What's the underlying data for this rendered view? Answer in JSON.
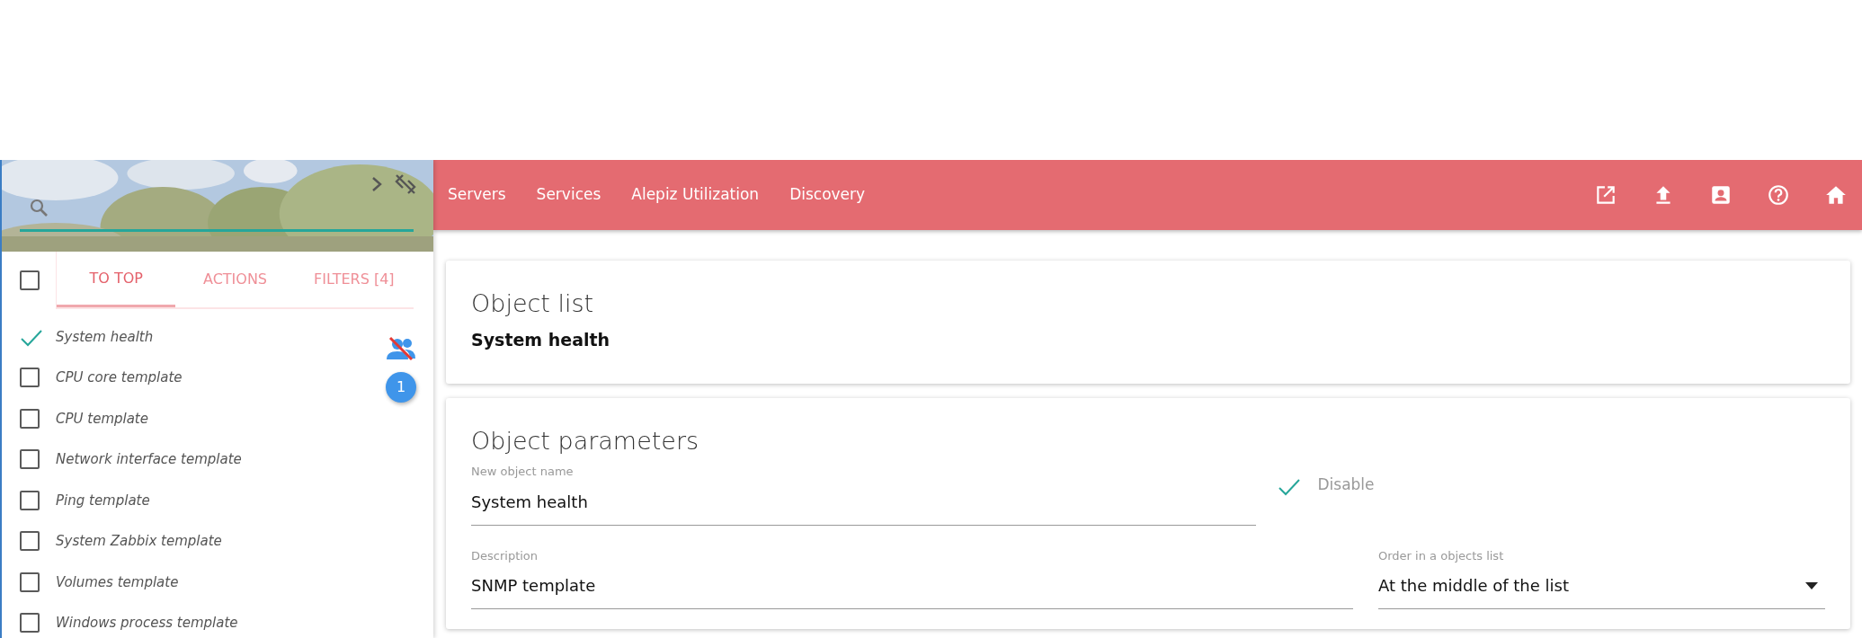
{
  "sidebar": {
    "select_all": {
      "checked": false
    },
    "tabs": [
      {
        "label": "TO TOP",
        "selected": true
      },
      {
        "label": "ACTIONS",
        "selected": false
      },
      {
        "label": "FILTERS [4]",
        "selected": false
      }
    ],
    "items": [
      {
        "label": "System health",
        "checked": true
      },
      {
        "label": "CPU core template",
        "checked": false
      },
      {
        "label": "CPU template",
        "checked": false
      },
      {
        "label": "Network interface template",
        "checked": false
      },
      {
        "label": "Ping template",
        "checked": false
      },
      {
        "label": "System Zabbix template",
        "checked": false
      },
      {
        "label": "Volumes template",
        "checked": false
      },
      {
        "label": "Windows process template",
        "checked": false
      }
    ],
    "count_badge": "1"
  },
  "navbar": {
    "links": [
      "Servers",
      "Services",
      "Alepiz Utilization",
      "Discovery"
    ]
  },
  "object_list": {
    "title": "Object list",
    "selection": "System health"
  },
  "object_parameters": {
    "title": "Object parameters",
    "name_field": {
      "label": "New object name",
      "value": "System health"
    },
    "disable": {
      "label": "Disable",
      "checked": true
    },
    "description_field": {
      "label": "Description",
      "value": "SNMP template"
    },
    "order_field": {
      "label": "Order in a objects list",
      "value": "At the middle of the list"
    }
  }
}
